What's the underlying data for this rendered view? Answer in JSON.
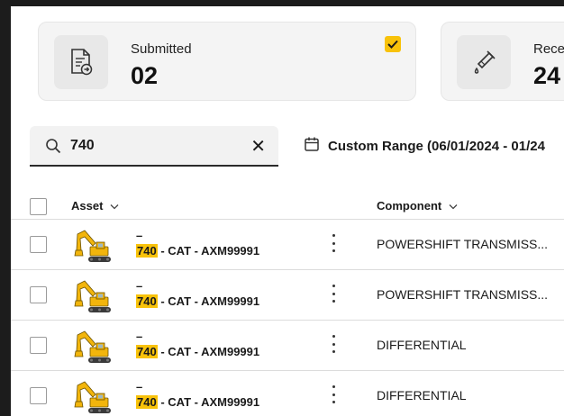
{
  "cards": [
    {
      "label": "Submitted",
      "value": "02",
      "icon": "document-submit-icon",
      "checked": true
    },
    {
      "label": "Rece",
      "value": "24",
      "icon": "oil-sample-icon"
    }
  ],
  "search": {
    "value": "740",
    "clear_icon": "close-icon",
    "icon": "search-icon"
  },
  "date_filter": {
    "label": "Custom Range (06/01/2024 - 01/24",
    "icon": "calendar-icon"
  },
  "table": {
    "headers": {
      "asset": "Asset",
      "component": "Component"
    },
    "rows": [
      {
        "dash": "–",
        "asset_highlight": "740",
        "asset_rest": " - CAT - AXM99991",
        "component": "POWERSHIFT TRANSMISS..."
      },
      {
        "dash": "–",
        "asset_highlight": "740",
        "asset_rest": " - CAT - AXM99991",
        "component": "POWERSHIFT TRANSMISS..."
      },
      {
        "dash": "–",
        "asset_highlight": "740",
        "asset_rest": " - CAT - AXM99991",
        "component": "DIFFERENTIAL"
      },
      {
        "dash": "–",
        "asset_highlight": "740",
        "asset_rest": " - CAT - AXM99991",
        "component": "DIFFERENTIAL"
      }
    ]
  },
  "colors": {
    "accent": "#f8c20a",
    "card_bg": "#f4f4f4"
  }
}
